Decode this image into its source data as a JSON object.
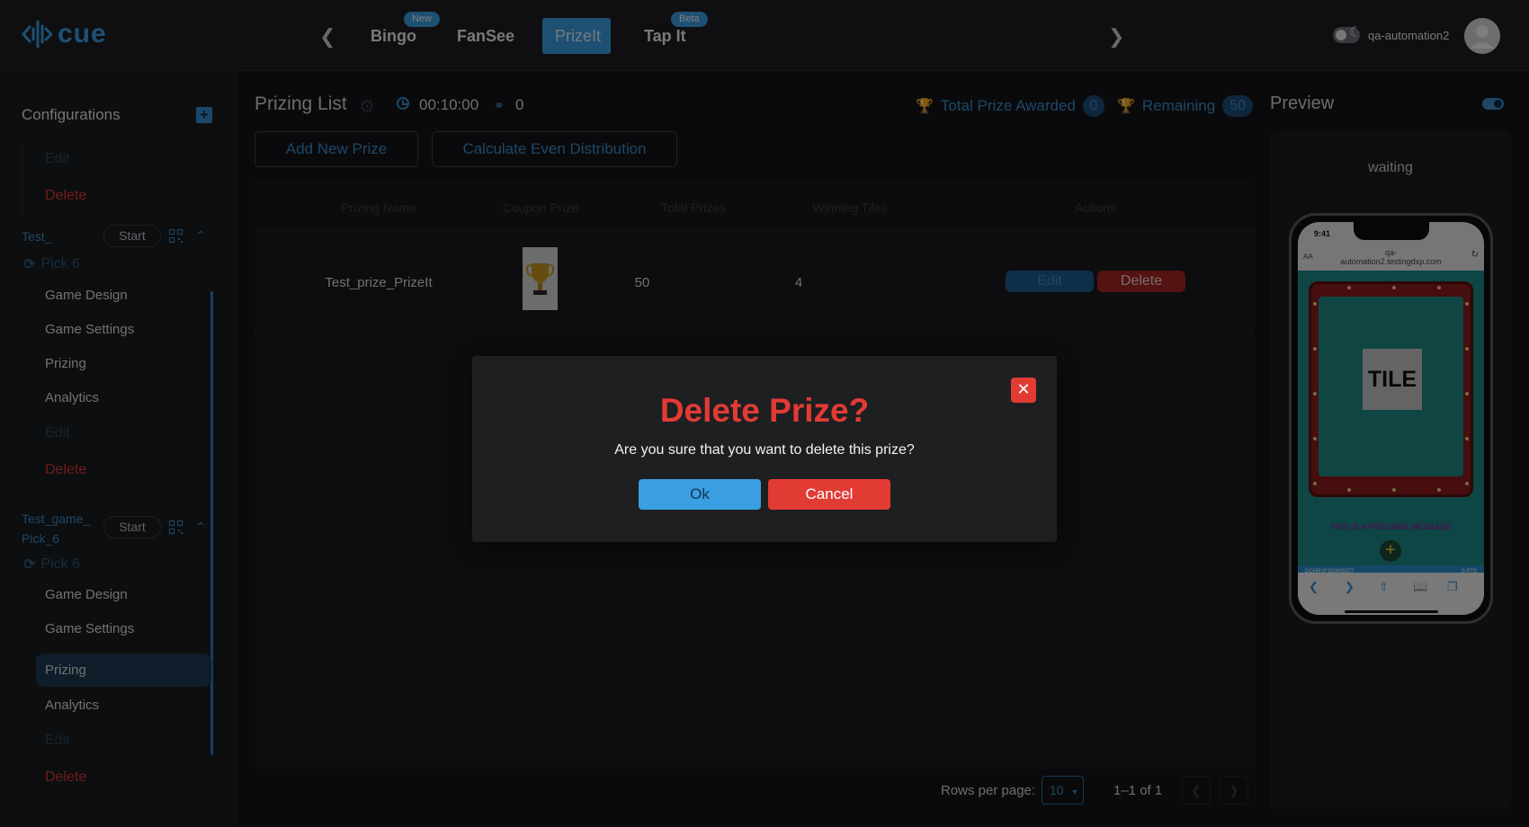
{
  "brand": {
    "logo_text": "cue",
    "accent": "#3aa0e6",
    "danger": "#e23b34"
  },
  "topnav": {
    "tabs": [
      {
        "label": "Bingo",
        "badge": "New"
      },
      {
        "label": "FanSee",
        "badge": ""
      },
      {
        "label": "PrizeIt",
        "badge": "",
        "active": true
      },
      {
        "label": "Tap It",
        "badge": "Beta"
      }
    ],
    "username": "qa-automation2"
  },
  "sidebar": {
    "heading": "Configurations",
    "top_items": {
      "edit": "Edit",
      "delete": "Delete"
    },
    "groups": [
      {
        "title": "Test_",
        "start": "Start",
        "game": "Pick 6",
        "items": [
          "Game Design",
          "Game Settings",
          "Prizing",
          "Analytics"
        ],
        "edit": "Edit",
        "delete": "Delete"
      },
      {
        "title_line1": "Test_game_",
        "title_line2": "Pick_6",
        "start": "Start",
        "game": "Pick 6",
        "items": [
          "Game Design",
          "Game Settings",
          "Prizing",
          "Analytics"
        ],
        "selected": "Prizing",
        "edit": "Edit",
        "delete": "Delete"
      }
    ]
  },
  "main": {
    "title": "Prizing List",
    "timer": "00:10:00",
    "players": "0",
    "total_awarded_label": "Total Prize Awarded",
    "total_awarded": "0",
    "remaining_label": "Remaining",
    "remaining": "50",
    "add_button": "Add New Prize",
    "calc_button": "Calculate Even Distribution",
    "table": {
      "headers": [
        "Prizing Name",
        "Coupon Prize",
        "Total Prizes",
        "Winning Tiles",
        "Actions"
      ],
      "rows": [
        {
          "name": "Test_prize_PrizeIt",
          "total": "50",
          "winning": "4",
          "edit": "Edit",
          "delete": "Delete"
        }
      ]
    },
    "pager": {
      "rows_label": "Rows per page:",
      "rows_value": "10",
      "range": "1–1 of 1"
    }
  },
  "preview": {
    "title": "Preview",
    "status": "waiting",
    "phone": {
      "time": "9:41",
      "url_line1": "qa-",
      "url_line2": "automation2.testingdxp.com",
      "text_size": "AA",
      "tile": "TILE",
      "message": "THIS IS A PREGAME MESSAGE",
      "player_id": "DCHR1P150608377",
      "points": "0 PTS"
    }
  },
  "modal": {
    "title": "Delete Prize?",
    "message": "Are you sure that you want to delete this prize?",
    "ok": "Ok",
    "cancel": "Cancel"
  }
}
